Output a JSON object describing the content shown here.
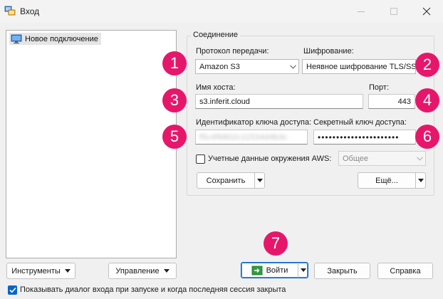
{
  "window": {
    "title": "Вход"
  },
  "sites": [
    {
      "label": "Новое подключение"
    }
  ],
  "connection": {
    "caption": "Соединение",
    "protocol_label": "Протокол передачи:",
    "protocol_value": "Amazon S3",
    "encryption_label": "Шифрование:",
    "encryption_value": "Неявное шифрование TLS/SSL",
    "host_label": "Имя хоста:",
    "host_value": "s3.inferit.cloud",
    "port_label": "Порт:",
    "port_value": "443",
    "access_key_label": "Идентификатор ключа доступа:",
    "access_key_value": "f5c4f6802c11534d4b3c",
    "secret_key_label": "Секретный ключ доступа:",
    "secret_key_value": "••••••••••••••••••••••",
    "aws_env_label": "Учетные данные окружения AWS:",
    "aws_env_checked": false,
    "aws_profile_value": "Общее",
    "save_label": "Сохранить",
    "more_label": "Ещё..."
  },
  "bottom": {
    "tools_label": "Инструменты",
    "manage_label": "Управление",
    "login_label": "Войти",
    "close_label": "Закрыть",
    "help_label": "Справка",
    "show_dialog_label": "Показывать диалог входа при запуске и когда последняя сессия закрыта",
    "show_dialog_checked": true
  },
  "annotations": [
    "1",
    "2",
    "3",
    "4",
    "5",
    "6",
    "7"
  ],
  "colors": {
    "badge": "#e6176b",
    "accent": "#0a64c8"
  }
}
